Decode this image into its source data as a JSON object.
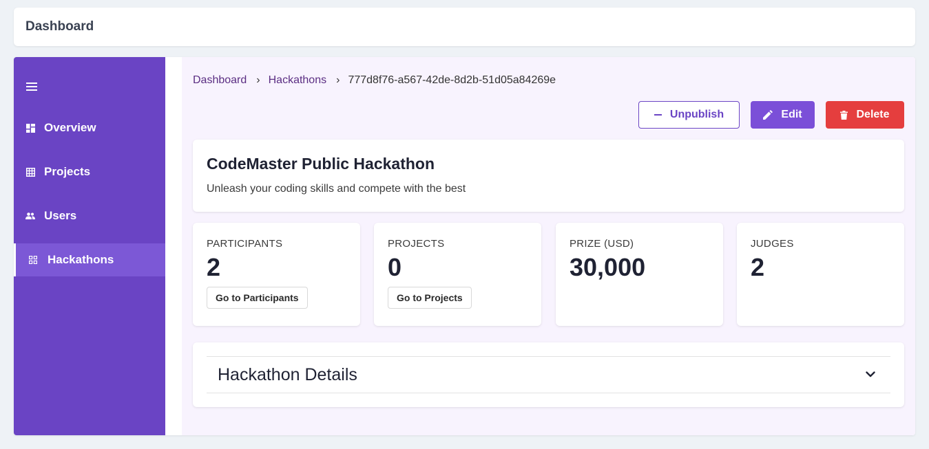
{
  "topbar": {
    "title": "Dashboard"
  },
  "sidebar": {
    "menu_icon": "hamburger-menu-icon",
    "items": [
      {
        "label": "Overview",
        "icon": "dashboard-icon",
        "active": false
      },
      {
        "label": "Projects",
        "icon": "grid-table-icon",
        "active": false
      },
      {
        "label": "Users",
        "icon": "users-icon",
        "active": false
      },
      {
        "label": "Hackathons",
        "icon": "apps-grid-icon",
        "active": true
      }
    ]
  },
  "breadcrumb": {
    "items": [
      "Dashboard",
      "Hackathons"
    ],
    "current": "777d8f76-a567-42de-8d2b-51d05a84269e"
  },
  "actions": {
    "unpublish": "Unpublish",
    "edit": "Edit",
    "delete": "Delete"
  },
  "hackathon": {
    "title": "CodeMaster Public Hackathon",
    "subtitle": "Unleash your coding skills and compete with the best"
  },
  "stats": [
    {
      "label": "PARTICIPANTS",
      "value": "2",
      "button": "Go to Participants"
    },
    {
      "label": "PROJECTS",
      "value": "0",
      "button": "Go to Projects"
    },
    {
      "label": "PRIZE (USD)",
      "value": "30,000"
    },
    {
      "label": "JUDGES",
      "value": "2"
    }
  ],
  "details": {
    "title": "Hackathon Details",
    "expanded": false
  },
  "colors": {
    "sidebar": "#6a44c4",
    "sidebar_active": "#7c58d6",
    "main_bg": "#f8f3fe",
    "edit": "#7b4fd8",
    "delete": "#e53e3e"
  }
}
